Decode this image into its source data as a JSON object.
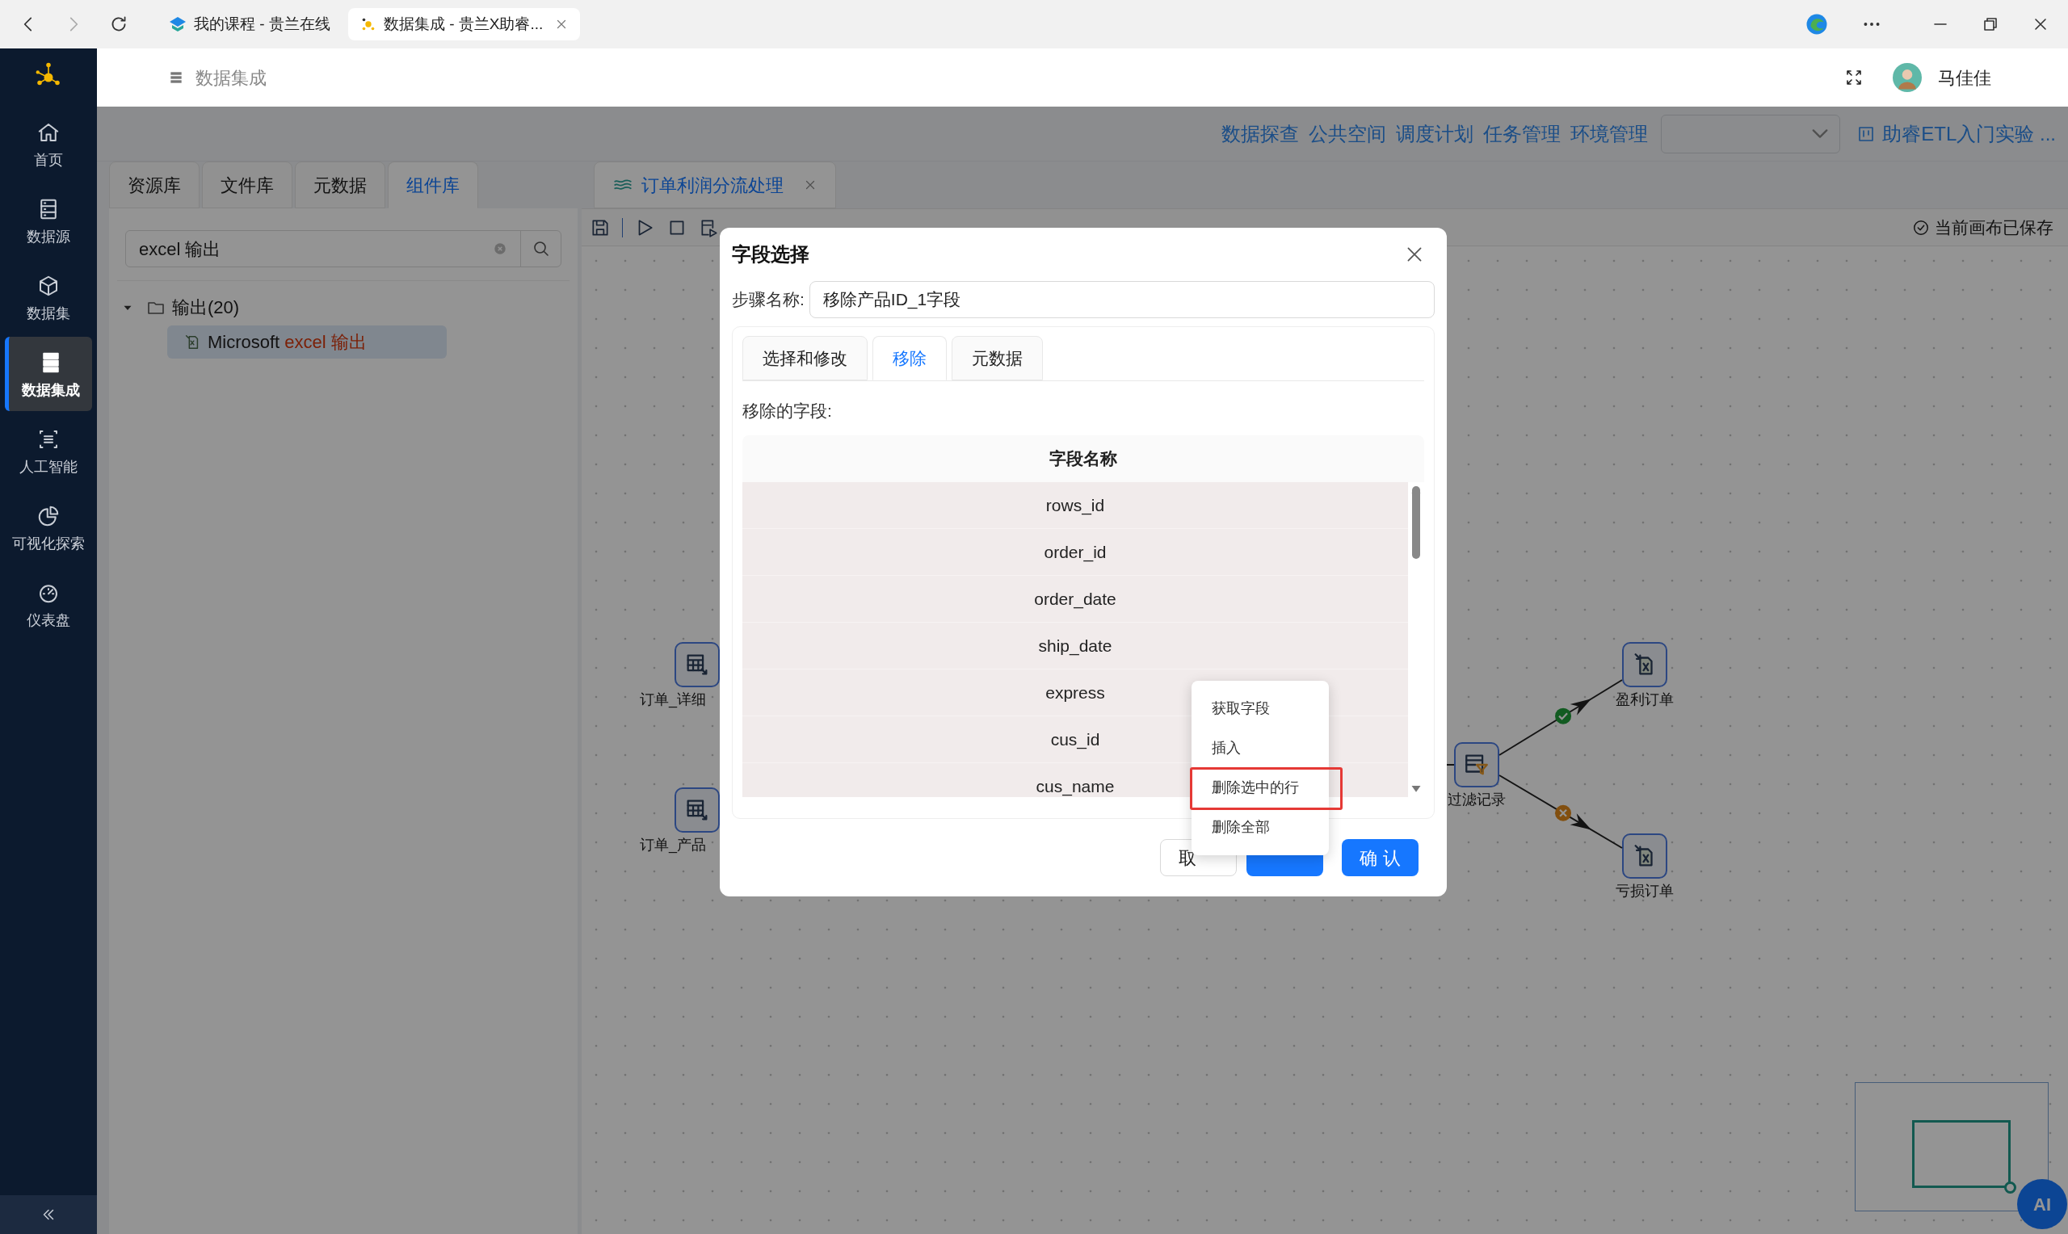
{
  "browser": {
    "tabs": [
      {
        "title": "我的课程 - 贵兰在线",
        "selected": false
      },
      {
        "title": "数据集成 - 贵兰X助睿...",
        "selected": true
      }
    ]
  },
  "sidebar": {
    "items": [
      {
        "label": "首页",
        "selected": false
      },
      {
        "label": "数据源",
        "selected": false
      },
      {
        "label": "数据集",
        "selected": false
      },
      {
        "label": "数据集成",
        "selected": true
      },
      {
        "label": "人工智能",
        "selected": false
      },
      {
        "label": "可视化探索",
        "selected": false
      },
      {
        "label": "仪表盘",
        "selected": false
      }
    ]
  },
  "header": {
    "title": "数据集成",
    "user": "马佳佳"
  },
  "top_nav": {
    "links": [
      "数据探查",
      "公共空间",
      "调度计划",
      "任务管理",
      "环境管理"
    ],
    "project": "助睿ETL入门实验 ..."
  },
  "library": {
    "tabs": [
      {
        "label": "资源库",
        "selected": false
      },
      {
        "label": "文件库",
        "selected": false
      },
      {
        "label": "元数据",
        "selected": false
      },
      {
        "label": "组件库",
        "selected": true
      }
    ],
    "search": {
      "value": "excel 输出"
    },
    "tree": [
      {
        "label": "输出(20)",
        "expanded": true,
        "children": [
          {
            "label": "Microsoft ",
            "match": "excel 输出",
            "selected": true
          }
        ]
      }
    ]
  },
  "canvas": {
    "tab": "订单利润分流处理",
    "save_status": "当前画布已保存",
    "nodes": [
      {
        "label": "订单_详细",
        "kind": "table"
      },
      {
        "label": "订单_产品",
        "kind": "table"
      },
      {
        "label": "过滤记录",
        "kind": "filter"
      },
      {
        "label": "盈利订单",
        "kind": "excel"
      },
      {
        "label": "亏损订单",
        "kind": "excel"
      }
    ],
    "edges": [
      {
        "kind": "plain"
      },
      {
        "kind": "pass"
      },
      {
        "kind": "fail"
      }
    ],
    "ai_button": "AI"
  },
  "dialog": {
    "title": "字段选择",
    "step_label": "步骤名称:",
    "step_value": "移除产品ID_1字段",
    "tabs": [
      {
        "label": "选择和修改",
        "selected": false
      },
      {
        "label": "移除",
        "selected": true
      },
      {
        "label": "元数据",
        "selected": false
      }
    ],
    "section_label": "移除的字段:",
    "table": {
      "columns": [
        "字段名称"
      ],
      "rows": [
        {
          "name": "rows_id",
          "selected": true
        },
        {
          "name": "order_id",
          "selected": true
        },
        {
          "name": "order_date",
          "selected": true
        },
        {
          "name": "ship_date",
          "selected": true
        },
        {
          "name": "express",
          "selected": true
        },
        {
          "name": "cus_id",
          "selected": true
        },
        {
          "name": "cus_name",
          "selected": true
        }
      ]
    },
    "buttons": [
      {
        "label": "取",
        "kind": "default"
      },
      {
        "kind": "primary"
      },
      {
        "label": "确 认",
        "kind": "primary"
      }
    ]
  },
  "context_menu": {
    "items": [
      {
        "label": "获取字段",
        "highlighted": false
      },
      {
        "label": "插入",
        "highlighted": false
      },
      {
        "label": "删除选中的行",
        "highlighted": true
      },
      {
        "label": "删除全部",
        "highlighted": false
      }
    ]
  }
}
